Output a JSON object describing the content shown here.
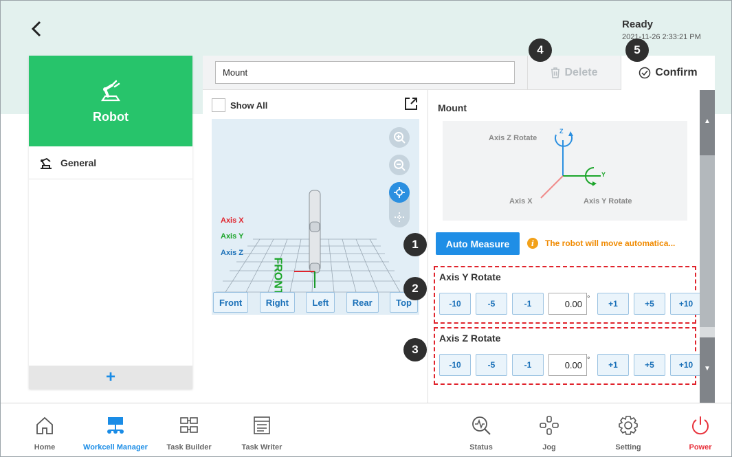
{
  "header": {
    "status": "Ready",
    "timestamp": "2021-11-26 2:33:21 PM"
  },
  "sidebar": {
    "card_label": "Robot",
    "items": [
      {
        "label": "General"
      }
    ],
    "add_label": "+"
  },
  "editor": {
    "name_value": "Mount",
    "delete_label": "Delete",
    "confirm_label": "Confirm"
  },
  "viewer": {
    "show_all_label": "Show All",
    "axis_labels": {
      "x": "Axis X",
      "y": "Axis Y",
      "z": "Axis Z"
    },
    "floor_text": "FRONT",
    "view_buttons": [
      "Front",
      "Right",
      "Left",
      "Rear",
      "Top"
    ]
  },
  "mount": {
    "title": "Mount",
    "diagram": {
      "z_rotate": "Axis Z Rotate",
      "x": "Axis X",
      "y_rotate": "Axis Y Rotate",
      "z": "Z",
      "y": "Y"
    },
    "auto_measure_label": "Auto Measure",
    "warning": "The robot will move automatica...",
    "axis_y": {
      "title": "Axis Y Rotate",
      "minus": [
        "-10",
        "-5",
        "-1"
      ],
      "value": "0.00",
      "plus": [
        "+1",
        "+5",
        "+10"
      ]
    },
    "axis_z": {
      "title": "Axis Z Rotate",
      "minus": [
        "-10",
        "-5",
        "-1"
      ],
      "value": "0.00",
      "plus": [
        "+1",
        "+5",
        "+10"
      ]
    }
  },
  "callouts": [
    "1",
    "2",
    "3",
    "4",
    "5"
  ],
  "nav": [
    {
      "label": "Home",
      "icon": "home-icon"
    },
    {
      "label": "Workcell Manager",
      "icon": "workcell-icon"
    },
    {
      "label": "Task Builder",
      "icon": "task-builder-icon"
    },
    {
      "label": "Task Writer",
      "icon": "task-writer-icon"
    },
    {
      "label": "Status",
      "icon": "status-icon"
    },
    {
      "label": "Jog",
      "icon": "jog-icon"
    },
    {
      "label": "Setting",
      "icon": "gear-icon"
    },
    {
      "label": "Power",
      "icon": "power-icon"
    }
  ],
  "colors": {
    "accent": "#1f8ee6",
    "robot_card": "#27c46b",
    "active_nav": "#1a8ce6",
    "power": "#e8323c",
    "warning": "#f08a00",
    "highlight": "#e0232c"
  }
}
